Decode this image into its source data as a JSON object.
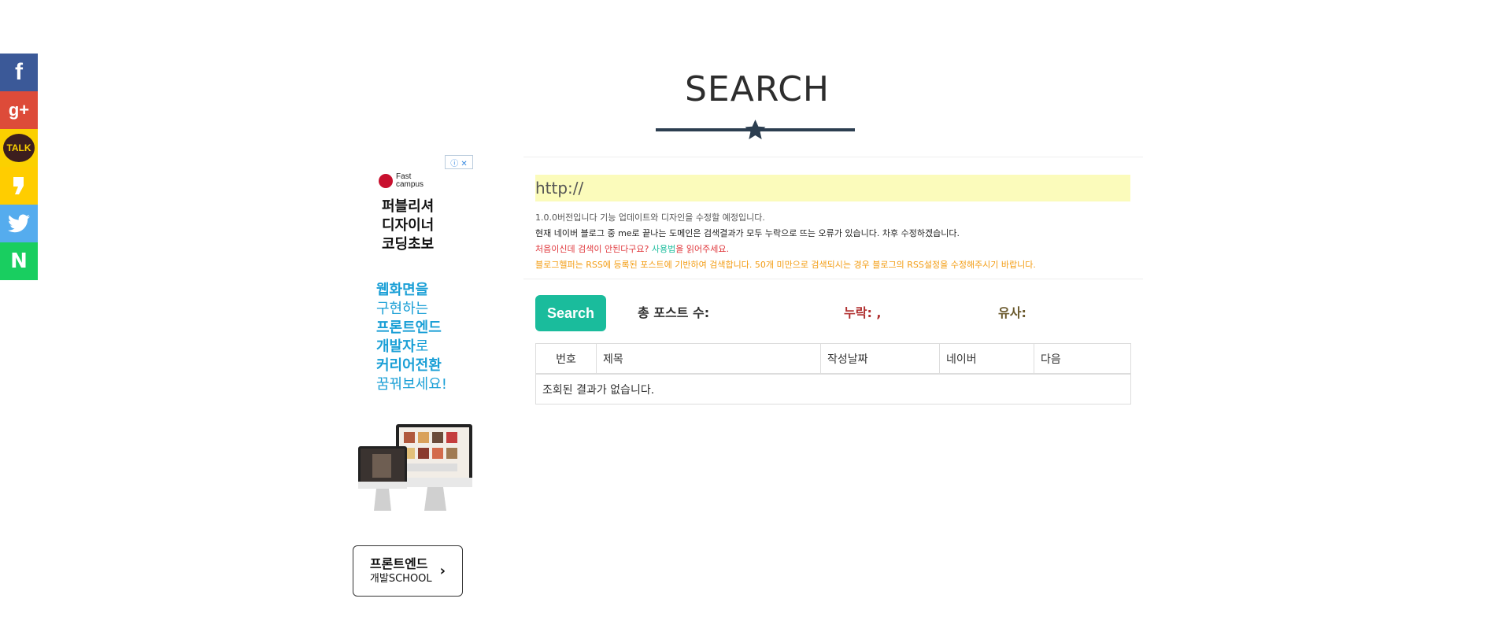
{
  "share": {
    "facebook_glyph": "f",
    "googleplus_glyph": "g+",
    "kakaotalk_label": "TALK",
    "kakaostory_glyph": "❜",
    "naver_glyph": "N",
    "colors": {
      "facebook": "#3b5998",
      "googleplus": "#dd4b39",
      "kakaotalk": "#fbd000",
      "kakaostory": "#ffcd00",
      "twitter": "#55acee",
      "naver": "#19ce60"
    }
  },
  "page": {
    "title": "SEARCH"
  },
  "ad": {
    "logo_line1": "Fast",
    "logo_line2": "campus",
    "headline": [
      "퍼블리셔",
      "디자이너",
      "코딩초보"
    ],
    "body": [
      {
        "strong": "웹화면을",
        "rest": ""
      },
      {
        "strong": "",
        "rest": "구현하는"
      },
      {
        "strong": "프론트엔드",
        "rest": ""
      },
      {
        "strong": "개발자",
        "rest": "로"
      },
      {
        "strong": "커리어전환",
        "rest": ""
      },
      {
        "strong": "",
        "rest": "꿈꿔보세요!"
      }
    ],
    "cta_line1": "프론트엔드",
    "cta_line2": "개발SCHOOL",
    "cta_arrow": "›"
  },
  "search": {
    "url_placeholder": "http://",
    "url_value": "",
    "note_version": "1.0.0버전입니다 기능 업데이트와 디자인을 수정할 예정입니다.",
    "note_bug": "현재 네이버 블로그 중 me로 끝나는 도메인은 검색결과가 모두 누락으로 뜨는 오류가 있습니다. 차후 수정하겠습니다.",
    "note_first_a": "처음이신데 검색이 안된다구요? ",
    "note_first_link": "사용법",
    "note_first_b": "을 읽어주세요.",
    "note_rss": "블로그헬퍼는 RSS에 등록된 포스트에 기반하여 검색합니다. 50개 미만으로 검색되시는 경우 블로그의 RSS설정을 수정해주시기 바랍니다.",
    "button_label": "Search",
    "total_posts_label": "총 포스트 수:",
    "missing_label": "누락: ,",
    "similar_label": "유사:"
  },
  "results": {
    "columns": [
      "번호",
      "제목",
      "작성날짜",
      "네이버",
      "다음"
    ],
    "empty_message": "조회된 결과가 없습니다."
  },
  "colors": {
    "accent": "#1abc9c",
    "title_dark": "#2c3e50",
    "url_bg": "#fbfbbb",
    "error_red": "#e0393e",
    "warn_orange": "#f39c12"
  }
}
